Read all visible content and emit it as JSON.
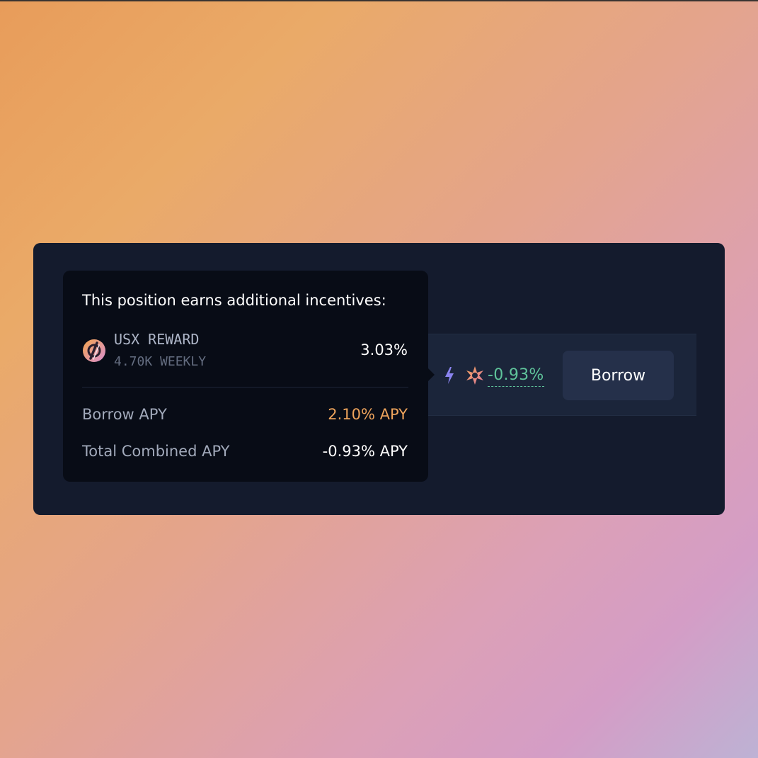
{
  "tooltip": {
    "title": "This position earns additional incentives:",
    "reward": {
      "icon": "usx-logo-icon",
      "name": "USX REWARD",
      "weekly": "4.70K WEEKLY",
      "value": "3.03%"
    },
    "borrow_apy": {
      "label": "Borrow APY",
      "value": "2.10% APY"
    },
    "total_apy": {
      "label": "Total Combined APY",
      "value": "-0.93% APY"
    }
  },
  "row": {
    "icons": [
      "lightning-bolt-icon",
      "star-icon"
    ],
    "apy": "-0.93%",
    "borrow_button_label": "Borrow"
  },
  "colors": {
    "positive_apy": "#5fc49b",
    "borrow_apy": "#eea45c",
    "bolt": "#8a84f0",
    "panel": "#141b2d",
    "tooltip": "#080c16"
  }
}
